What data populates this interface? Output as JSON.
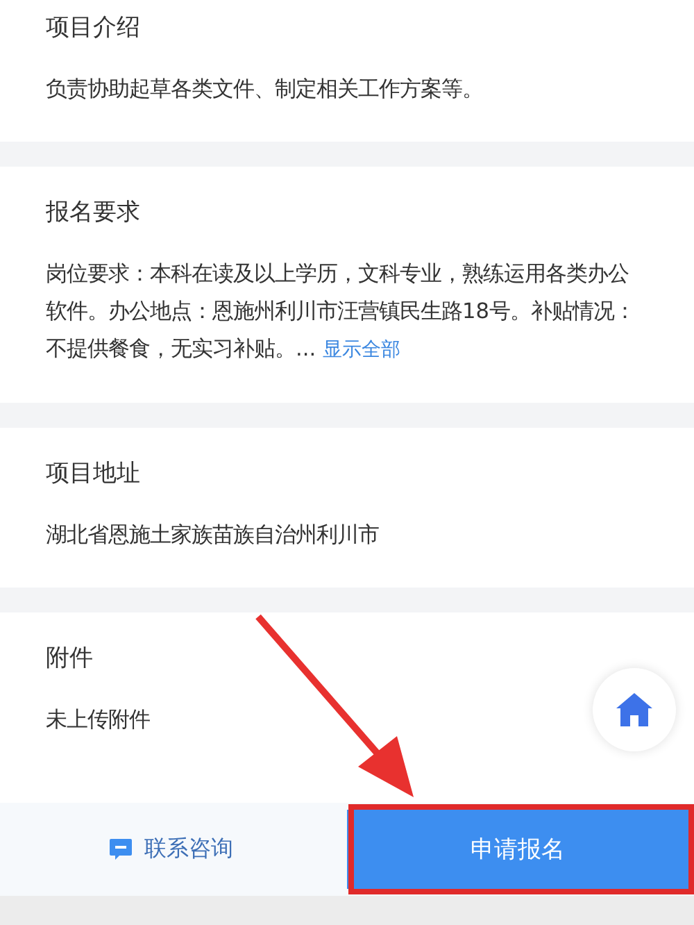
{
  "sections": [
    {
      "title": "项目介绍",
      "body": "负责协助起草各类文件、制定相关工作方案等。"
    },
    {
      "title": "报名要求",
      "body": "岗位要求：本科在读及以上学历，文科专业，熟练运用各类办公软件。办公地点：恩施州利川市汪营镇民生路18号。补贴情况：不提供餐食，无实习补贴。...",
      "link": "显示全部"
    },
    {
      "title": "项目地址",
      "body": "湖北省恩施土家族苗族自治州利川市"
    },
    {
      "title": "附件",
      "body": "未上传附件"
    }
  ],
  "bottom_bar": {
    "contact": "联系咨询",
    "apply": "申请报名"
  }
}
